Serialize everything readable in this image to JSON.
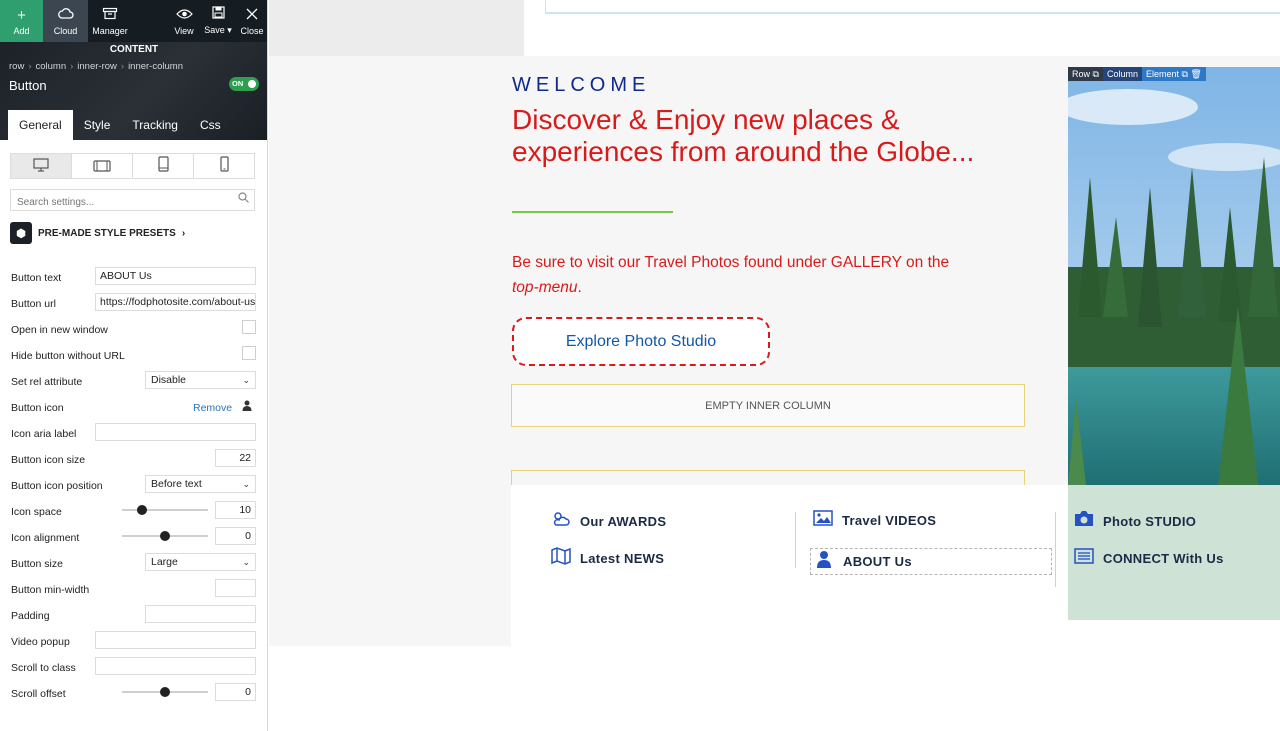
{
  "toolbar": {
    "add": "Add",
    "cloud": "Cloud",
    "manager": "Manager",
    "view": "View",
    "save": "Save",
    "close": "Close"
  },
  "panel": {
    "section_title": "CONTENT",
    "breadcrumbs": [
      "row",
      "column",
      "inner-row",
      "inner-column"
    ],
    "element_title": "Button",
    "toggle": "ON",
    "tabs": [
      "General",
      "Style",
      "Tracking",
      "Css"
    ],
    "search_placeholder": "Search settings...",
    "presets_label": "PRE-MADE STYLE PRESETS"
  },
  "settings": {
    "button_text": {
      "label": "Button text",
      "value": "ABOUT Us"
    },
    "button_url": {
      "label": "Button url",
      "value": "https://fodphotosite.com/about-us"
    },
    "new_window": {
      "label": "Open in new window"
    },
    "hide_without_url": {
      "label": "Hide button without URL"
    },
    "rel": {
      "label": "Set rel attribute",
      "value": "Disable"
    },
    "icon": {
      "label": "Button icon",
      "remove": "Remove"
    },
    "aria": {
      "label": "Icon aria label",
      "value": ""
    },
    "icon_size": {
      "label": "Button icon size",
      "value": "22"
    },
    "icon_position": {
      "label": "Button icon position",
      "value": "Before text"
    },
    "icon_space": {
      "label": "Icon space",
      "value": "10",
      "level": 0.23
    },
    "icon_alignment": {
      "label": "Icon alignment",
      "value": "0",
      "level": 0.5
    },
    "size": {
      "label": "Button size",
      "value": "Large"
    },
    "min_width": {
      "label": "Button min-width",
      "value": ""
    },
    "padding": {
      "label": "Padding",
      "value": ""
    },
    "video_popup": {
      "label": "Video popup",
      "value": ""
    },
    "scroll_class": {
      "label": "Scroll to class",
      "value": ""
    },
    "scroll_offset": {
      "label": "Scroll offset",
      "value": "0",
      "level": 0.5
    }
  },
  "canvas": {
    "welcome": "WELCOME",
    "headline": "Discover & Enjoy new places & experiences from around the Globe...",
    "visit_text": "Be sure to visit our Travel Photos found under GALLERY on the ",
    "visit_em": "top-menu",
    "visit_end": ".",
    "explore_button": "Explore Photo Studio",
    "empty_column": "EMPTY INNER COLUMN",
    "ctrl": {
      "row": "Row",
      "column": "Column",
      "element": "Element"
    },
    "menu": {
      "awards": "Our AWARDS",
      "news": "Latest NEWS",
      "videos": "Travel VIDEOS",
      "about": "ABOUT Us",
      "studio": "Photo STUDIO",
      "connect": "CONNECT With Us"
    }
  },
  "colors": {
    "accent_green": "#2f9f6f",
    "headline_red": "#d91a1a",
    "welcome_blue": "#102a8a",
    "link_blue": "#1257a8",
    "menu_icon_blue": "#2452c4"
  },
  "icons": {
    "add": "plus-icon",
    "cloud": "cloud-icon",
    "manager": "manager-icon",
    "view": "eye-icon",
    "save": "save-icon",
    "close": "close-icon",
    "search": "search-icon",
    "presets": "cube-icon",
    "button_icon": "user-icon",
    "awards": "cloud-sun-icon",
    "news": "map-icon",
    "videos": "image-icon",
    "about": "user-icon",
    "studio": "camera-icon",
    "connect": "list-icon"
  }
}
